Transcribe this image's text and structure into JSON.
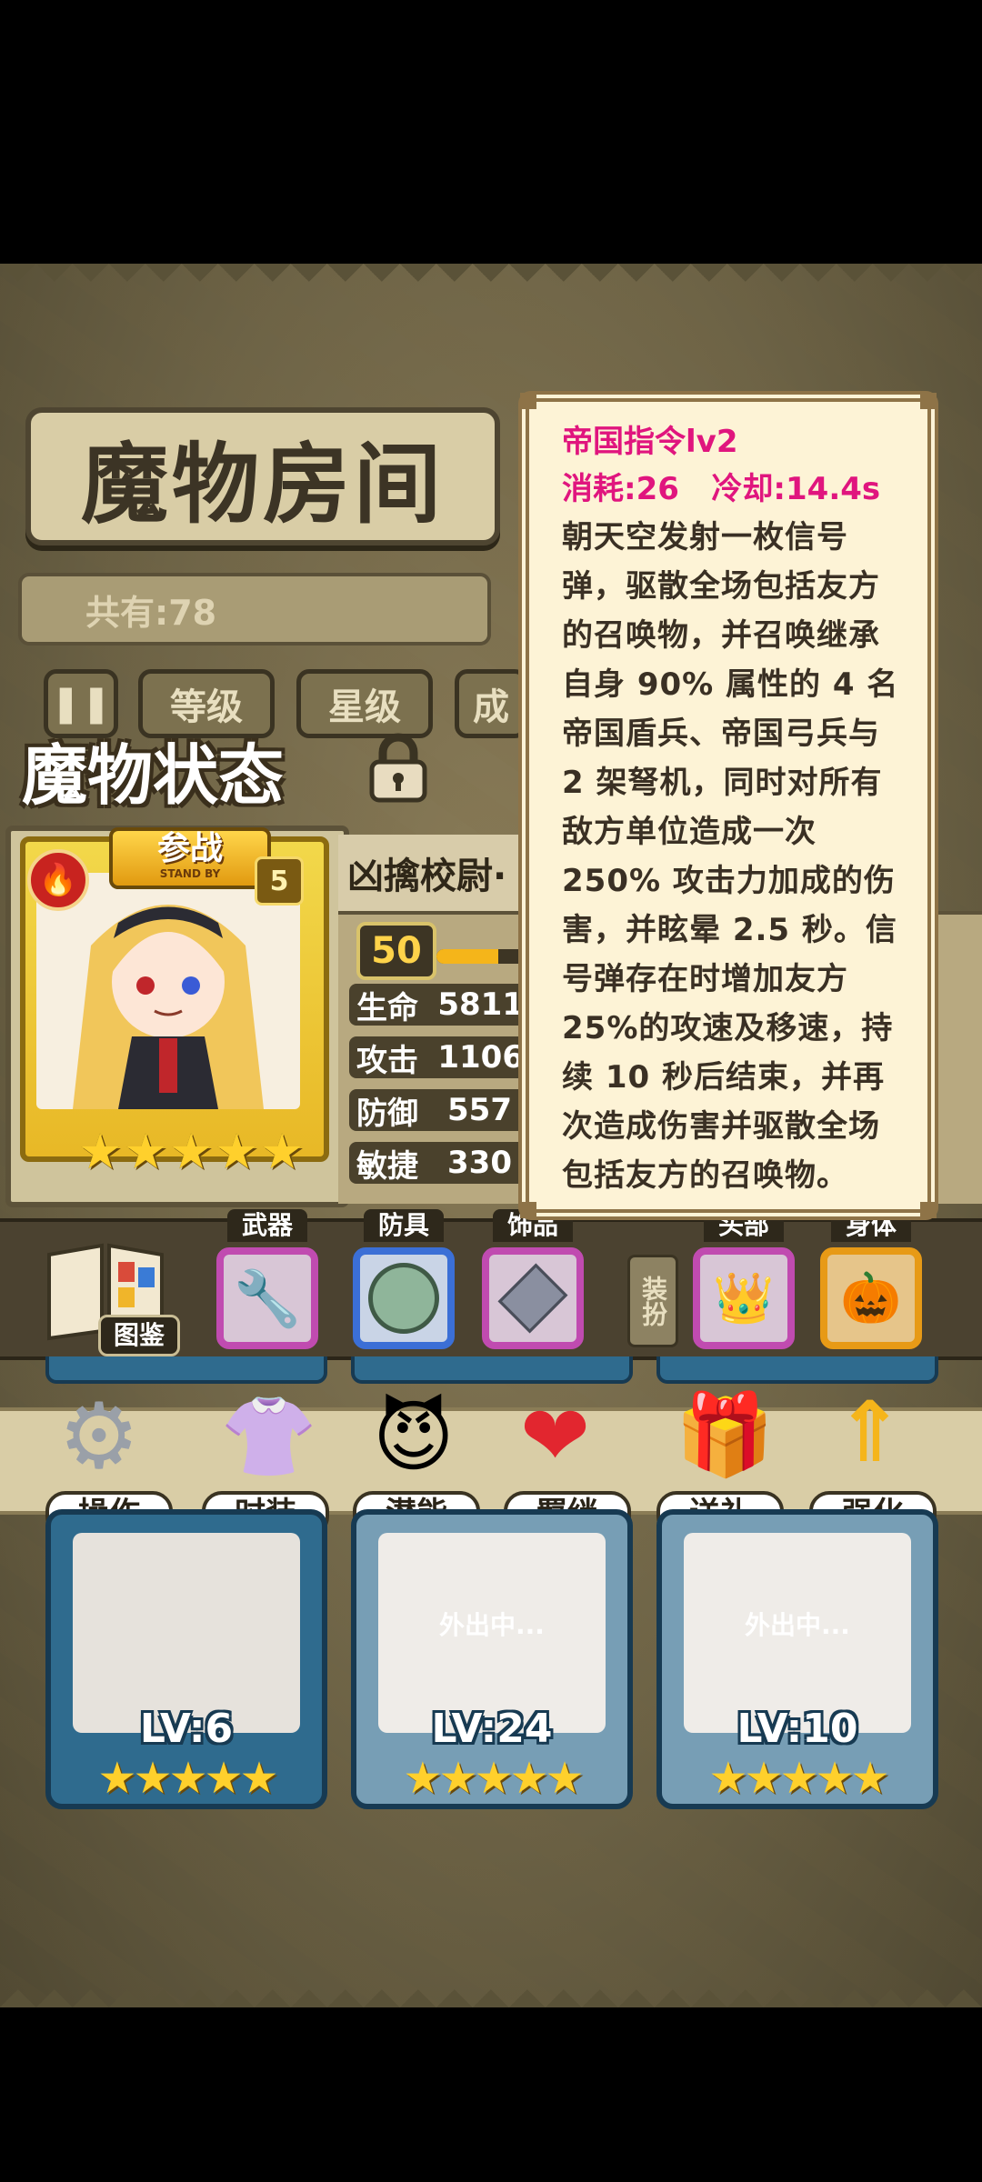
{
  "header": {
    "title": "魔物房间",
    "count_label": "共有:78",
    "filters": [
      "等级",
      "星级",
      "成"
    ]
  },
  "status": {
    "title": "魔物状态"
  },
  "character": {
    "standby_label": "参战",
    "standby_sub": "STAND BY",
    "badge_number": "5",
    "name": "凶擒校尉·",
    "level": "50",
    "xp_fraction": 0.62,
    "stars": 5,
    "stats": [
      {
        "label": "生命",
        "value": "5811"
      },
      {
        "label": "攻击",
        "value": "1106"
      },
      {
        "label": "防御",
        "value": "557"
      },
      {
        "label": "敏捷",
        "value": "330"
      }
    ]
  },
  "equipment": {
    "atlas_label": "图鉴",
    "dress_label": "装扮",
    "slots": [
      {
        "label": "武器",
        "icon": "wrench-icon",
        "color": "#c04bb0"
      },
      {
        "label": "防具",
        "icon": "shield-coin-icon",
        "color": "#3b6fd6"
      },
      {
        "label": "饰品",
        "icon": "amulet-icon",
        "color": "#c04bb0"
      },
      {
        "label": "头部",
        "icon": "tiara-icon",
        "color": "#c04bb0"
      },
      {
        "label": "身体",
        "icon": "pumpkin-icon",
        "color": "#e79a16"
      }
    ]
  },
  "actions": [
    {
      "label": "操作",
      "icon": "gear-icon"
    },
    {
      "label": "时装",
      "icon": "outfit-icon"
    },
    {
      "label": "潜能",
      "icon": "demon-icon"
    },
    {
      "label": "羁绊",
      "icon": "hearts-icon"
    },
    {
      "label": "送礼",
      "icon": "gift-icon"
    },
    {
      "label": "强化",
      "icon": "upgrade-arrows-icon"
    }
  ],
  "monsters": [
    {
      "level": "LV:6",
      "away": "",
      "stars": 5
    },
    {
      "level": "LV:24",
      "away": "外出中...",
      "stars": 5
    },
    {
      "level": "LV:10",
      "away": "外出中...",
      "stars": 5
    }
  ],
  "tooltip": {
    "title": "帝国指令lv2",
    "cost": "消耗:26   冷却:14.4s",
    "lines": [
      "朝天空发射一枚信号",
      "弹，驱散全场包括友方",
      "的召唤物，并召唤继承",
      "自身 90% 属性的 4 名",
      "帝国盾兵、帝国弓兵与",
      "2 架弩机，同时对所有",
      "敌方单位造成一次",
      "250% 攻击力加成的伤",
      "害，并眩晕 2.5 秒。信",
      "号弹存在时增加友方",
      "25%的攻速及移速，持",
      "续 10 秒后结束，并再",
      "次造成伤害并驱散全场",
      "包括友方的召唤物。"
    ]
  }
}
